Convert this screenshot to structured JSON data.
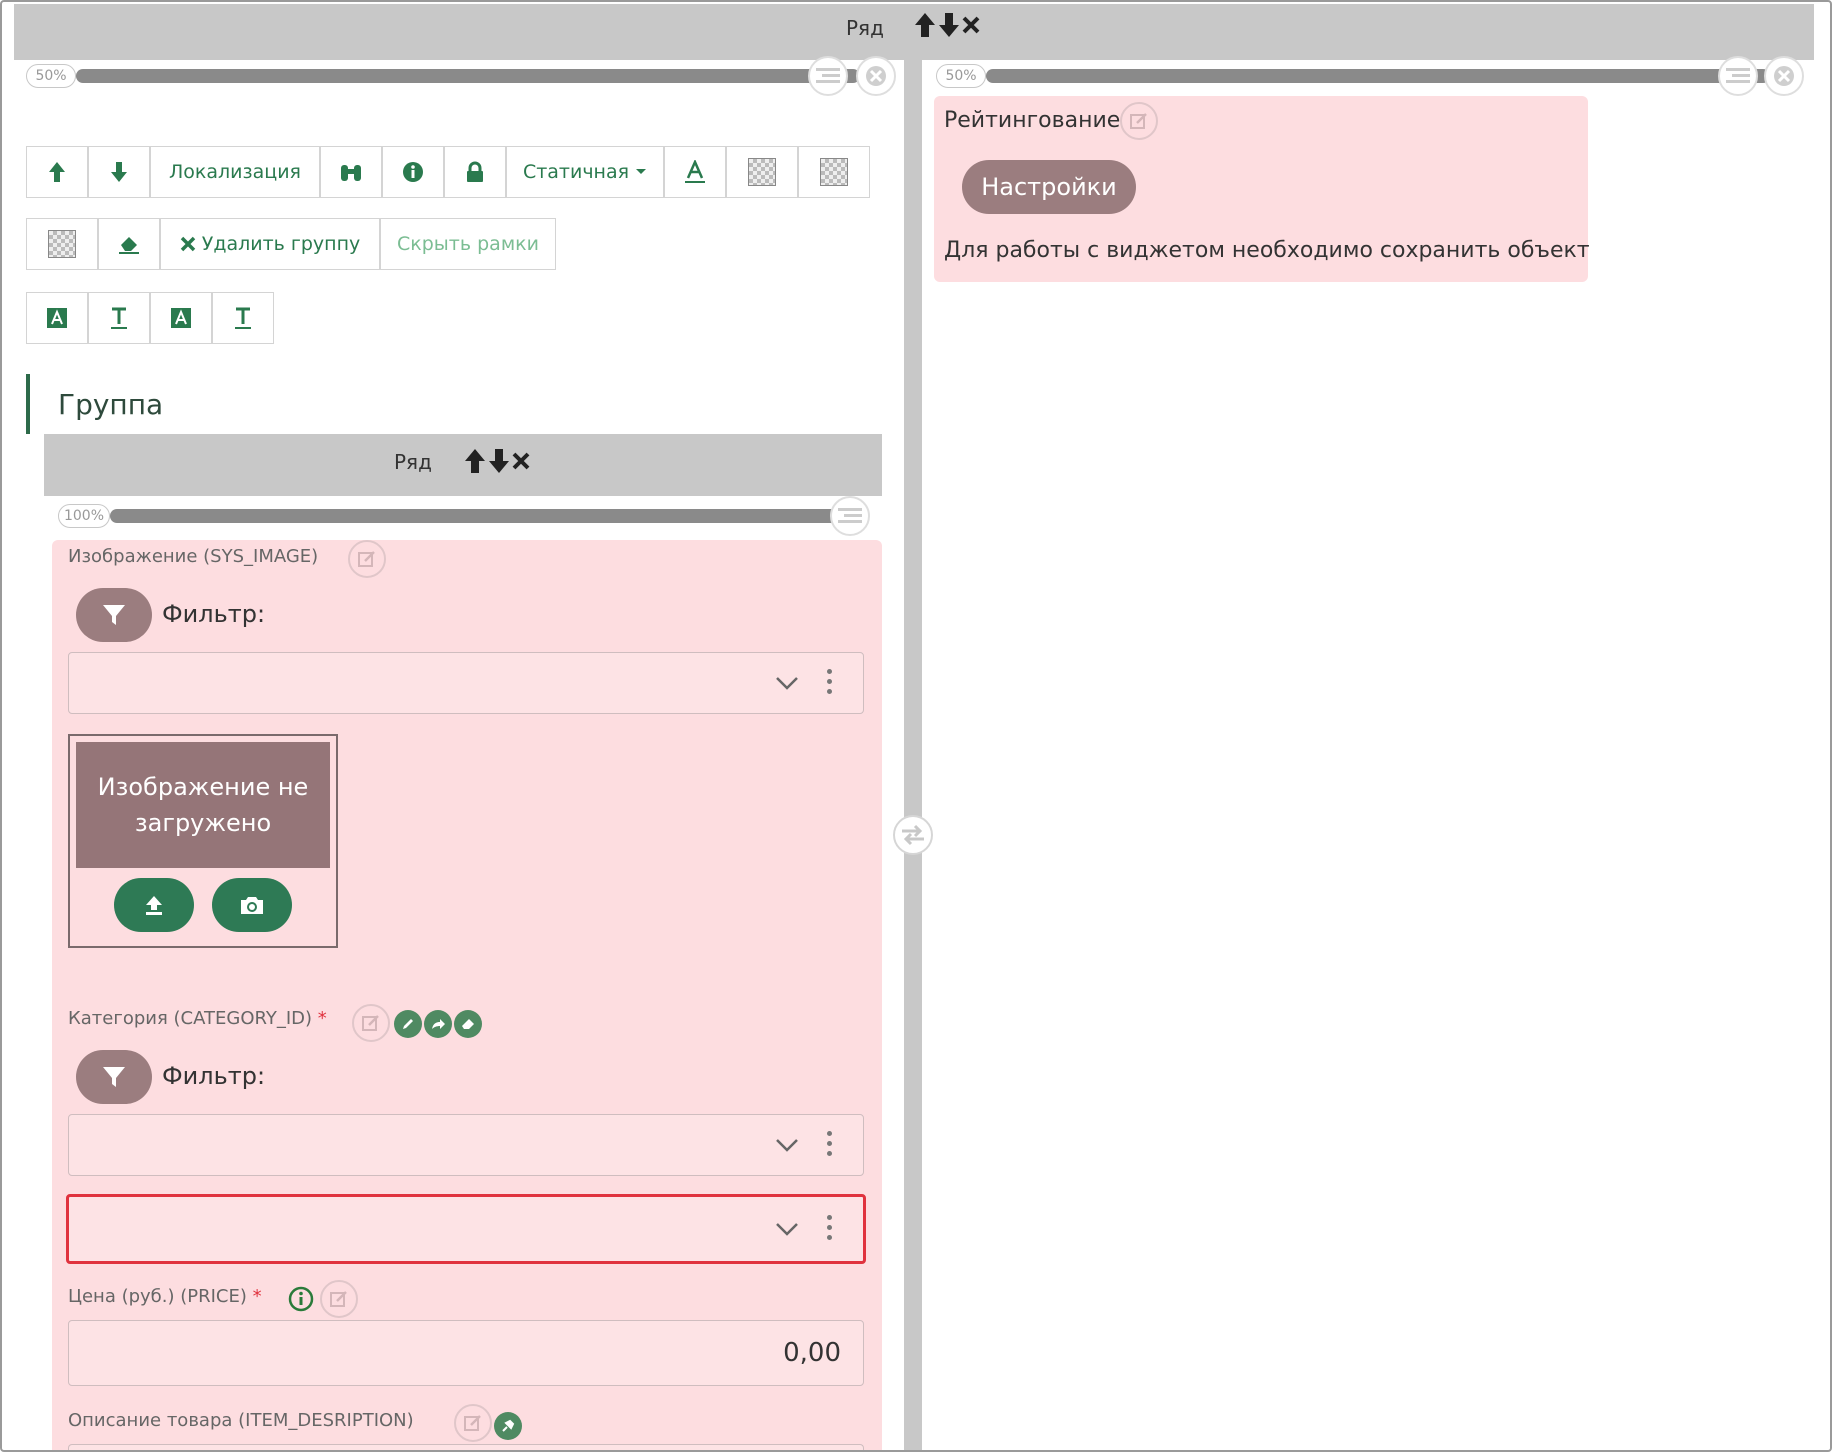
{
  "top_row": {
    "label": "Ряд"
  },
  "left_col": {
    "width_pct": "50%"
  },
  "right_col": {
    "width_pct": "50%"
  },
  "toolbar": {
    "localization": "Локализация",
    "static": "Статичная",
    "delete_group": "Удалить группу",
    "hide_frames": "Скрыть рамки"
  },
  "group": {
    "title": "Группа"
  },
  "inner_row": {
    "label": "Ряд",
    "width_pct": "100%"
  },
  "fields": {
    "image": {
      "label": "Изображение (SYS_IMAGE)",
      "filter_label": "Фильтр:",
      "placeholder": "Изображение не загружено"
    },
    "category": {
      "label": "Категория (CATEGORY_ID)",
      "required": "*",
      "filter_label": "Фильтр:"
    },
    "price": {
      "label": "Цена (руб.) (PRICE)",
      "required": "*",
      "value": "0,00"
    },
    "description": {
      "label": "Описание товара (ITEM_DESRIPTION)"
    }
  },
  "rating_widget": {
    "title": "Рейтингование",
    "settings_button": "Настройки",
    "note": "Для работы с виджетом необходимо сохранить объект"
  }
}
